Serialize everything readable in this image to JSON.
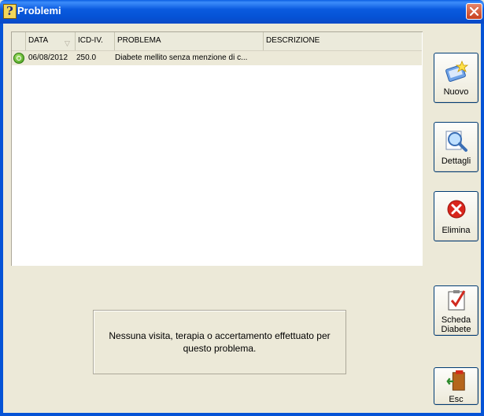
{
  "window": {
    "title": "Problemi",
    "icon": "help-question-icon",
    "close_icon": "close-icon"
  },
  "grid": {
    "columns": [
      "DATA",
      "ICD-IV.",
      "PROBLEMA",
      "DESCRIZIONE"
    ],
    "sort_indicator": "▽",
    "rows": [
      {
        "status_icon": "active-status-icon",
        "data": "06/08/2012",
        "icd": "250.0",
        "problema": "Diabete mellito senza menzione di c...",
        "descrizione": ""
      }
    ]
  },
  "buttons": {
    "nuovo": {
      "label": "Nuovo",
      "icon": "new-record-icon"
    },
    "dettagli": {
      "label": "Dettagli",
      "icon": "magnifier-icon"
    },
    "elimina": {
      "label": "Elimina",
      "icon": "delete-icon"
    },
    "scheda": {
      "label_line1": "Scheda",
      "label_line2": "Diabete",
      "icon": "checklist-icon"
    },
    "esc": {
      "label": "Esc",
      "icon": "exit-door-icon"
    }
  },
  "message": {
    "text_line1": "Nessuna visita, terapia o accertamento effettuato per",
    "text_line2": "questo problema."
  },
  "colors": {
    "titlebar": "#0553d6",
    "window_bg": "#ece9d8",
    "selected_row": "#ece9d8",
    "grid_bg": "#ffffff"
  }
}
